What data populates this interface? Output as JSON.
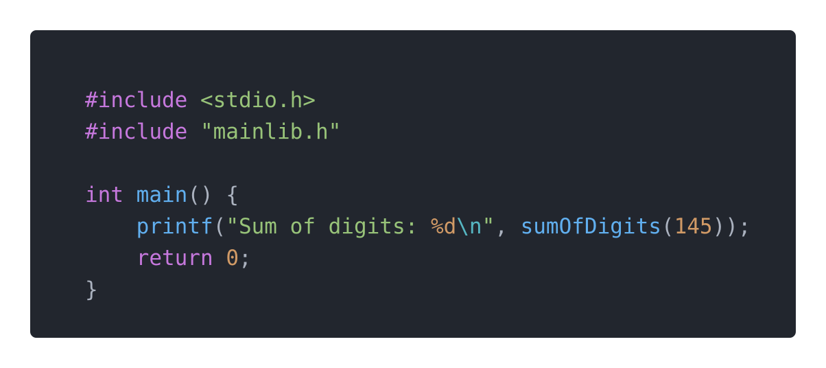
{
  "theme": {
    "page_background": "#ffffff",
    "editor_background": "#22262e",
    "default_text": "#abb2bf",
    "keyword": "#c678dd",
    "string": "#98c379",
    "function": "#61afef",
    "number": "#d19a66",
    "escape": "#56b6c2"
  },
  "code": {
    "language": "c",
    "lines": [
      [
        {
          "t": "#include",
          "k": "directive"
        },
        {
          "t": " ",
          "k": "punct"
        },
        {
          "t": "<stdio.h>",
          "k": "header"
        }
      ],
      [
        {
          "t": "#include",
          "k": "directive"
        },
        {
          "t": " ",
          "k": "punct"
        },
        {
          "t": "\"mainlib.h\"",
          "k": "header"
        }
      ],
      [],
      [
        {
          "t": "int",
          "k": "type"
        },
        {
          "t": " ",
          "k": "punct"
        },
        {
          "t": "main",
          "k": "func"
        },
        {
          "t": "() {",
          "k": "punct"
        }
      ],
      [
        {
          "t": "    ",
          "k": "punct"
        },
        {
          "t": "printf",
          "k": "func"
        },
        {
          "t": "(",
          "k": "punct"
        },
        {
          "t": "\"Sum of digits: ",
          "k": "string"
        },
        {
          "t": "%d",
          "k": "format"
        },
        {
          "t": "\\n",
          "k": "escape"
        },
        {
          "t": "\"",
          "k": "string"
        },
        {
          "t": ", ",
          "k": "punct"
        },
        {
          "t": "sumOfDigits",
          "k": "func"
        },
        {
          "t": "(",
          "k": "punct"
        },
        {
          "t": "145",
          "k": "number"
        },
        {
          "t": "));",
          "k": "punct"
        }
      ],
      [
        {
          "t": "    ",
          "k": "punct"
        },
        {
          "t": "return",
          "k": "keyword"
        },
        {
          "t": " ",
          "k": "punct"
        },
        {
          "t": "0",
          "k": "number"
        },
        {
          "t": ";",
          "k": "punct"
        }
      ],
      [
        {
          "t": "}",
          "k": "punct"
        }
      ]
    ]
  }
}
